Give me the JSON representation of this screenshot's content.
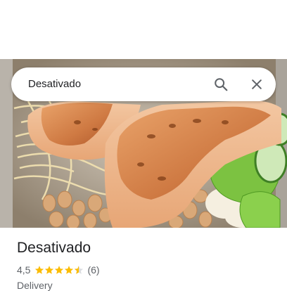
{
  "search": {
    "query": "Desativado"
  },
  "place": {
    "name": "Desativado",
    "rating": "4,5",
    "rating_value": 4.5,
    "review_count": "(6)",
    "category": "Delivery"
  },
  "colors": {
    "star": "#fbbc04",
    "text_primary": "#202124",
    "text_secondary": "#5f6368"
  },
  "icons": {
    "search": "search-icon",
    "close": "close-icon",
    "star": "star-icon"
  }
}
